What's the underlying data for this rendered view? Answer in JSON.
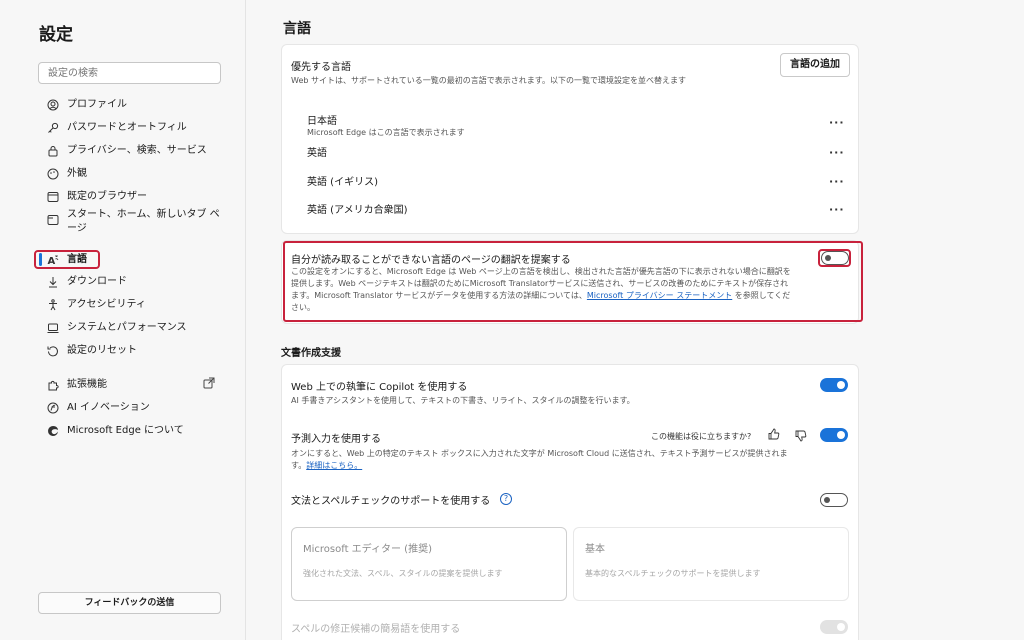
{
  "sidebar": {
    "title": "設定",
    "search_placeholder": "設定の検索",
    "items": [
      {
        "label": "プロファイル",
        "icon": "profile-icon"
      },
      {
        "label": "パスワードとオートフィル",
        "icon": "key-icon"
      },
      {
        "label": "プライバシー、検索、サービス",
        "icon": "lock-icon"
      },
      {
        "label": "外観",
        "icon": "appearance-icon"
      },
      {
        "label": "既定のブラウザー",
        "icon": "browser-icon"
      },
      {
        "label": "スタート、ホーム、新しいタブ ページ",
        "icon": "home-tab-icon"
      },
      {
        "label": "言語",
        "icon": "language-icon",
        "active": true
      },
      {
        "label": "ダウンロード",
        "icon": "download-icon"
      },
      {
        "label": "アクセシビリティ",
        "icon": "accessibility-icon"
      },
      {
        "label": "システムとパフォーマンス",
        "icon": "system-icon"
      },
      {
        "label": "設定のリセット",
        "icon": "reset-icon"
      },
      {
        "label": "拡張機能",
        "icon": "extensions-icon"
      },
      {
        "label": "AI イノベーション",
        "icon": "ai-icon"
      },
      {
        "label": "Microsoft Edge について",
        "icon": "edge-icon"
      }
    ],
    "feedback_label": "フィードバックの送信"
  },
  "main": {
    "title": "言語",
    "preferred": {
      "title": "優先する言語",
      "desc": "Web サイトは、サポートされている一覧の最初の言語で表示されます。以下の一覧で環境設定を並べ替えます",
      "add_label": "言語の追加",
      "languages": [
        {
          "name": "日本語",
          "sub": "Microsoft Edge はこの言語で表示されます"
        },
        {
          "name": "英語",
          "sub": ""
        },
        {
          "name": "英語 (イギリス)",
          "sub": ""
        },
        {
          "name": "英語 (アメリカ合衆国)",
          "sub": ""
        }
      ],
      "more_label": "···"
    },
    "translate": {
      "title": "自分が読み取ることができない言語のページの翻訳を提案する",
      "desc_1": "この設定をオンにすると、Microsoft Edge は Web ページ上の言語を検出し、検出された言語が優先言語の下に表示されない場合に翻訳を",
      "desc_2": "提供します。Web ページテキストは翻訳のためにMicrosoft Translatorサービスに送信され、サービスの改善のためにテキストが保存され",
      "desc_3a": "ます。Microsoft Translator サービスがデータを使用する方法の詳細については、",
      "desc_link": "Microsoft プライバシー ステートメント",
      "desc_3b": " を参照してくだ",
      "desc_4": "さい。",
      "enabled": false
    },
    "writing": {
      "title": "文書作成支援",
      "copilot": {
        "title": "Web 上での執筆に Copilot を使用する",
        "desc": "AI 手書きアシスタントを使用して、テキストの下書き、リライト、スタイルの調整を行います。",
        "enabled": true
      },
      "predictive": {
        "title": "予測入力を使用する",
        "feedback_q": "この機能は役に立ちますか?",
        "desc": "オンにすると、Web 上の特定のテキスト ボックスに入力された文字が Microsoft Cloud に送信され、テキスト予測サービスが提供されま",
        "desc_2a": "す。",
        "details_link": "詳細はこちら。",
        "enabled": true
      },
      "grammar": {
        "title": "文法とスペルチェックのサポートを使用する",
        "help_icon": "?",
        "enabled": false,
        "options": [
          {
            "title": "Microsoft エディター (推奨)",
            "desc": "強化された文法、スペル、スタイルの提案を提供します"
          },
          {
            "title": "基本",
            "desc": "基本的なスペルチェックのサポートを提供します"
          }
        ]
      },
      "spell_suggest": {
        "title": "スペルの修正候補の簡易語を使用する"
      }
    }
  },
  "colors": {
    "accent": "#1a73d9",
    "highlight": "#c8223c"
  }
}
